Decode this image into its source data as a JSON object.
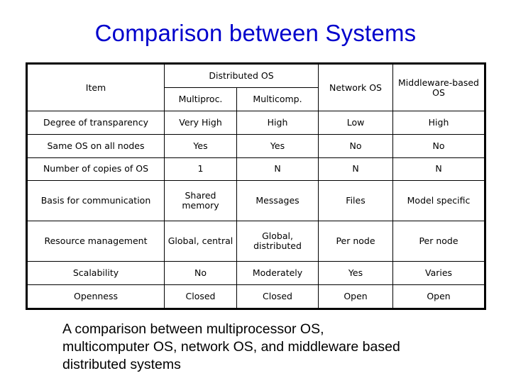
{
  "slide": {
    "title": "Comparison between Systems",
    "title_color": "#0000cc",
    "background_color": "#ffffff"
  },
  "table": {
    "header": {
      "item_label": "Item",
      "group_label": "Distributed OS",
      "sub_labels": [
        "Multiproc.",
        "Multicomp."
      ],
      "network_label": "Network OS",
      "middleware_label": "Middleware-based OS"
    },
    "columns": [
      "Item",
      "Multiproc.",
      "Multicomp.",
      "Network OS",
      "Middleware-based OS"
    ],
    "rows": [
      {
        "label": "Degree of transparency",
        "multiproc": "Very High",
        "multicomp": "High",
        "network": "Low",
        "middleware": "High"
      },
      {
        "label": "Same OS on all nodes",
        "multiproc": "Yes",
        "multicomp": "Yes",
        "network": "No",
        "middleware": "No"
      },
      {
        "label": "Number of copies of OS",
        "multiproc": "1",
        "multicomp": "N",
        "network": "N",
        "middleware": "N"
      },
      {
        "label": "Basis for communication",
        "multiproc": "Shared memory",
        "multicomp": "Messages",
        "network": "Files",
        "middleware": "Model specific"
      },
      {
        "label": "Resource management",
        "multiproc": "Global, central",
        "multicomp": "Global, distributed",
        "network": "Per node",
        "middleware": "Per node"
      },
      {
        "label": "Scalability",
        "multiproc": "No",
        "multicomp": "Moderately",
        "network": "Yes",
        "middleware": "Varies"
      },
      {
        "label": "Openness",
        "multiproc": "Closed",
        "multicomp": "Closed",
        "network": "Open",
        "middleware": "Open"
      }
    ]
  },
  "caption": {
    "line1": "A comparison between multiprocessor OS,",
    "line2": "multicomputer OS, network OS, and middleware based",
    "line3": "distributed systems"
  }
}
